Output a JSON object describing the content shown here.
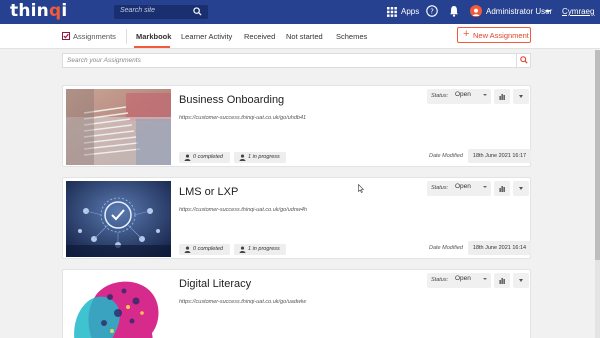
{
  "header": {
    "logo_main": "thin",
    "logo_q": "q",
    "logo_i": "i",
    "search_placeholder": "Search site",
    "apps_label": "Apps",
    "user_name": "Administrator User",
    "language_link": "Cymraeg"
  },
  "subnav": {
    "section_label": "Assignments",
    "tabs": [
      {
        "label": "Markbook",
        "active": true
      },
      {
        "label": "Learner Activity",
        "active": false
      },
      {
        "label": "Received",
        "active": false
      },
      {
        "label": "Not started",
        "active": false
      },
      {
        "label": "Schemes",
        "active": false
      }
    ],
    "new_button_label": "New Assignment"
  },
  "assignment_search": {
    "placeholder": "Search your Assignments"
  },
  "cards": [
    {
      "title": "Business Onboarding",
      "url": "https://customer-success.thinqi-uat.co.uk/go/uhdb41",
      "completed": "0 completed",
      "in_progress": "1 in progress",
      "status_label": "Status:",
      "status_value": "Open",
      "date_label": "Date Modified",
      "date_value": "18th June 2021 16:17"
    },
    {
      "title": "LMS or LXP",
      "url": "https://customer-success.thinqi-uat.co.uk/go/udnw4h",
      "completed": "0 completed",
      "in_progress": "1 in progress",
      "status_label": "Status:",
      "status_value": "Open",
      "date_label": "Date Modified",
      "date_value": "18th June 2021 16:14"
    },
    {
      "title": "Digital Literacy",
      "url": "https://customer-success.thinqi-uat.co.uk/go/uadwlw",
      "status_label": "Status:",
      "status_value": "Open"
    }
  ],
  "colors": {
    "header_bg": "#26418f",
    "accent": "#f15a3a",
    "page_bg": "#f1f1f1"
  }
}
